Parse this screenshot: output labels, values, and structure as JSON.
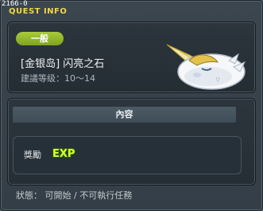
{
  "window": {
    "quest_id": "2166-0",
    "title": "QUEST INFO"
  },
  "quest": {
    "category_badge": "一般",
    "name": "[金银岛] 闪亮之石",
    "level_range": "建議等级：10～14",
    "npc_icon": "unicorn-mob-icon"
  },
  "content": {
    "header": "內容",
    "reward_label": "獎勵",
    "reward_icon_text": "EXP"
  },
  "status": {
    "text": "狀態： 可開始 / 不可執行任務"
  },
  "colors": {
    "title": "#f0d64a",
    "badge": "#8fb52a",
    "exp": "#d8ff3a"
  }
}
